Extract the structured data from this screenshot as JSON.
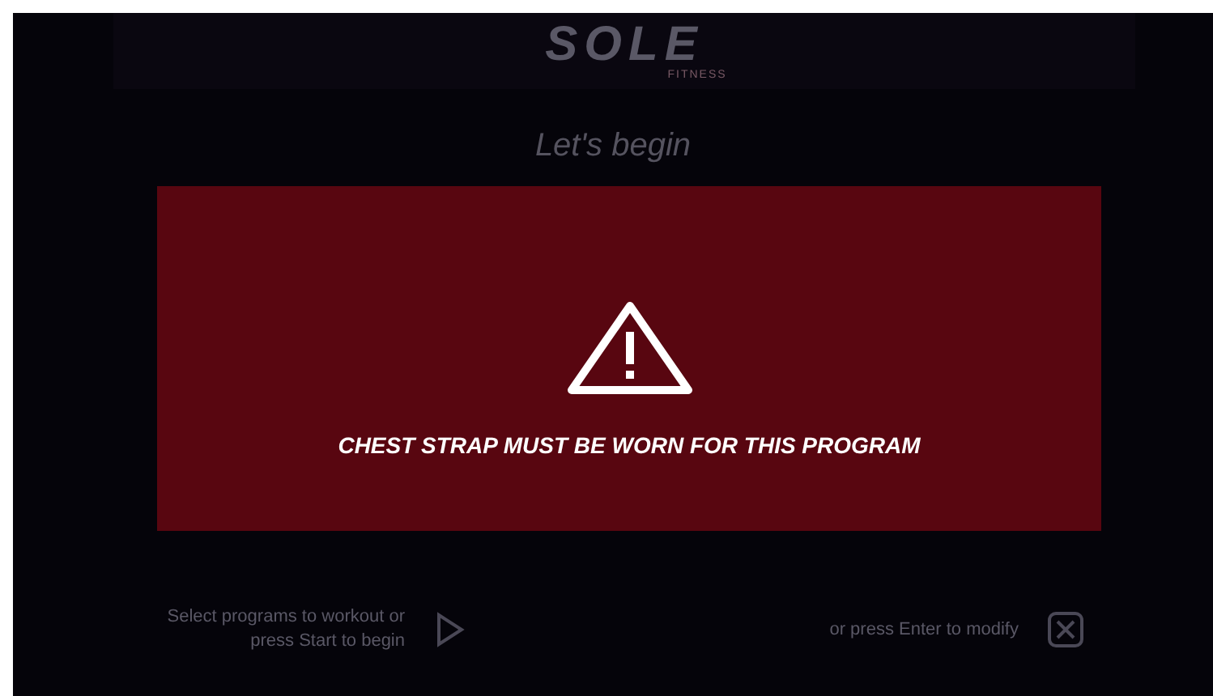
{
  "header": {
    "logo": "SOLE",
    "logo_subtitle": "FITNESS"
  },
  "heading": "Let's begin",
  "alert": {
    "message": "CHEST STRAP MUST BE WORN FOR THIS PROGRAM"
  },
  "hints": [
    {
      "kind": "start",
      "text": "Select programs to workout or press Start to begin"
    },
    {
      "kind": "modify",
      "text": "or press Enter to modify"
    }
  ]
}
